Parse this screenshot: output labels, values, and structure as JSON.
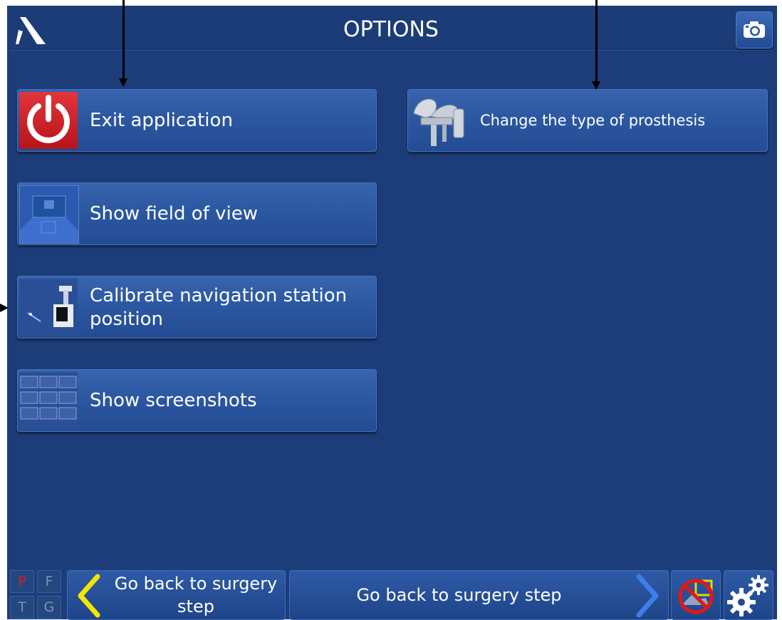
{
  "header": {
    "title": "OPTIONS"
  },
  "icons": {
    "logo": "brand-logo-icon",
    "camera": "camera-icon",
    "power": "power-icon",
    "view": "field-of-view-icon",
    "station": "navigation-station-icon",
    "screens": "screenshots-icon",
    "prosthesis": "prosthesis-icon",
    "back": "chevron-left-icon",
    "next": "chevron-right-icon",
    "tracking": "tracking-disabled-icon",
    "settings": "gear-icon"
  },
  "options": [
    {
      "label": "Exit application"
    },
    {
      "label": "Show field of view"
    },
    {
      "label": "Calibrate navigation station position"
    },
    {
      "label": "Show screenshots"
    },
    {
      "label": "Change the type of prosthesis"
    }
  ],
  "footer": {
    "indicators": [
      "P",
      "F",
      "T",
      "G"
    ],
    "back_label": "Go back to surgery step",
    "next_label": "Go back to surgery step"
  },
  "colors": {
    "background": "#1d3d7a",
    "button": "#2c58a2",
    "exit_red": "#d0202a",
    "indicator_red": "#e01818",
    "back_chevron": "#f2e600",
    "next_chevron": "#3c7fe8"
  }
}
